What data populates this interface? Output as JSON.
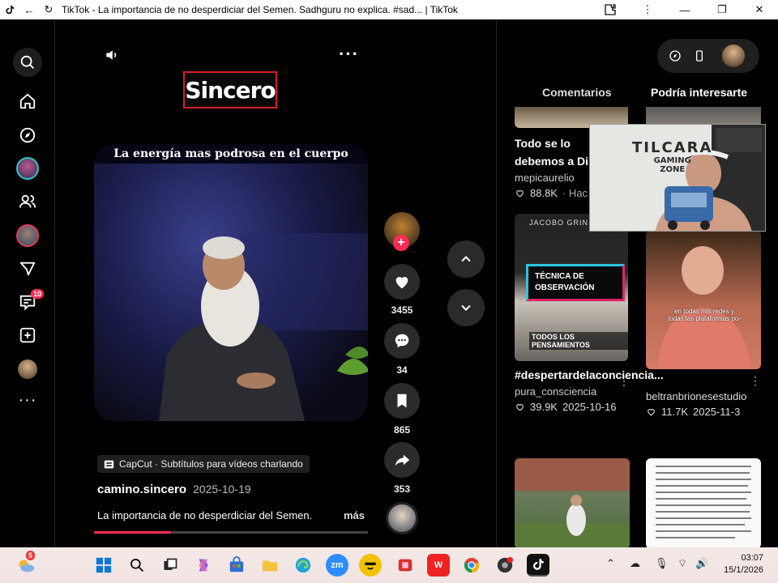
{
  "window": {
    "title": "TikTok - La importancia de no desperdiciar del Semen. Sadhguru no explica. #sad... | TikTok"
  },
  "leftnav": {
    "items": [
      {
        "name": "search-button",
        "icon": "search-icon"
      },
      {
        "name": "nav-home",
        "icon": "home-icon"
      },
      {
        "name": "nav-explore",
        "icon": "compass-icon"
      },
      {
        "name": "nav-live-avatar",
        "icon": "avatar"
      },
      {
        "name": "nav-following",
        "icon": "people-icon"
      },
      {
        "name": "nav-live-avatar-2",
        "icon": "avatar"
      },
      {
        "name": "nav-messages",
        "icon": "send-icon"
      },
      {
        "name": "nav-inbox",
        "icon": "inbox-icon"
      },
      {
        "name": "nav-upload",
        "icon": "plus-square-icon"
      },
      {
        "name": "nav-profile",
        "icon": "avatar"
      },
      {
        "name": "nav-more",
        "icon": "more-icon"
      }
    ],
    "inbox_badge": "10"
  },
  "video": {
    "brand_label": "Sincero",
    "caption": "La energía mas podrosa en el cuerpo",
    "capcut_label": "CapCut · Subtítulos para vídeos charlando",
    "author": "camino.sincero",
    "date": "2025-10-19",
    "description": "La importancia de no desperdiciar del Semen.",
    "more_label": "más",
    "progress": 0.28
  },
  "actions": {
    "likes": "3455",
    "comments": "34",
    "saves": "865",
    "shares": "353"
  },
  "rightpanel": {
    "tabs": [
      {
        "label": "Comentarios",
        "active": false
      },
      {
        "label": "Podría interesarte",
        "active": true
      }
    ],
    "cards": [
      {
        "title": "Todo se lo debemos a Di",
        "author": "mepicaurelio",
        "likes": "88.8K",
        "date": "· Hac"
      },
      {
        "title": "#despertardelaconciencia...",
        "author": "pura_consciencia",
        "likes": "39.9K",
        "date": "2025-10-16",
        "overlay_top": "JACOBO GRIN",
        "overlay_label": "TÉCNICA DE OBSERVACIÓN",
        "overlay_bottom": "TODOS LOS PENSAMIENTOS"
      },
      {
        "title": "",
        "author": "beltranbrionesestudio",
        "likes": "11.7K",
        "date": "2025-11-3",
        "overlay_text": "en todas mis redes y todas las plataformas po-"
      }
    ],
    "pip": {
      "line1": "TILCARA",
      "line2": "GAMING",
      "line3": "ZONE"
    }
  },
  "taskbar": {
    "weather_badge": "5",
    "time": "03:07",
    "date": "15/1/2026"
  }
}
